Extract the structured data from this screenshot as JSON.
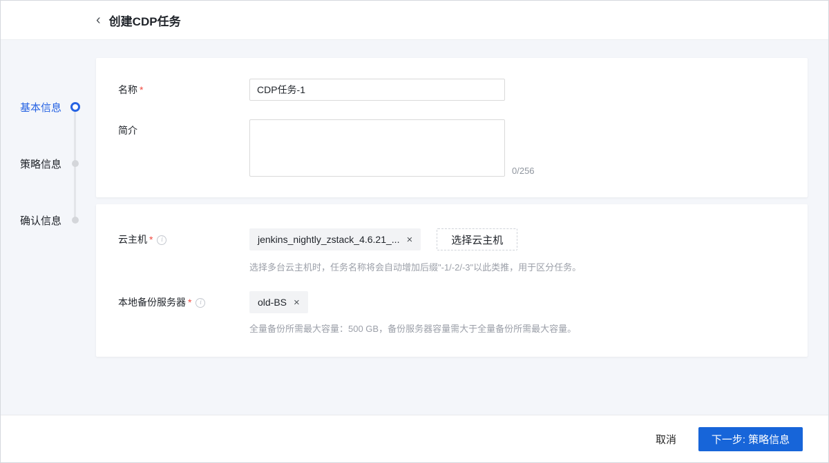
{
  "header": {
    "back_icon": "‹",
    "title": "创建CDP任务"
  },
  "stepper": {
    "steps": [
      {
        "label": "基本信息",
        "state": "active"
      },
      {
        "label": "策略信息",
        "state": "pending"
      },
      {
        "label": "确认信息",
        "state": "pending"
      }
    ]
  },
  "form": {
    "basic": {
      "name_label": "名称",
      "name_required": "*",
      "name_value": "CDP任务-1",
      "desc_label": "简介",
      "desc_value": "",
      "desc_counter": "0/256"
    },
    "resource": {
      "vm_label": "云主机",
      "vm_required": "*",
      "vm_info_icon": "i",
      "vm_tag": "jenkins_nightly_zstack_4.6.21_...",
      "vm_tag_close": "×",
      "vm_select_button": "选择云主机",
      "vm_hint": "选择多台云主机时，任务名称将会自动增加后缀\"-1/-2/-3\"以此类推，用于区分任务。",
      "bs_label": "本地备份服务器",
      "bs_required": "*",
      "bs_info_icon": "i",
      "bs_tag": "old-BS",
      "bs_tag_close": "×",
      "bs_hint": "全量备份所需最大容量：500 GB，备份服务器容量需大于全量备份所需最大容量。"
    }
  },
  "footer": {
    "cancel_label": "取消",
    "next_label": "下一步: 策略信息"
  },
  "colors": {
    "accent_blue": "#1765d9",
    "active_step_blue": "#2663e3",
    "required_red": "#f0483e",
    "page_background": "#f4f6fa"
  }
}
